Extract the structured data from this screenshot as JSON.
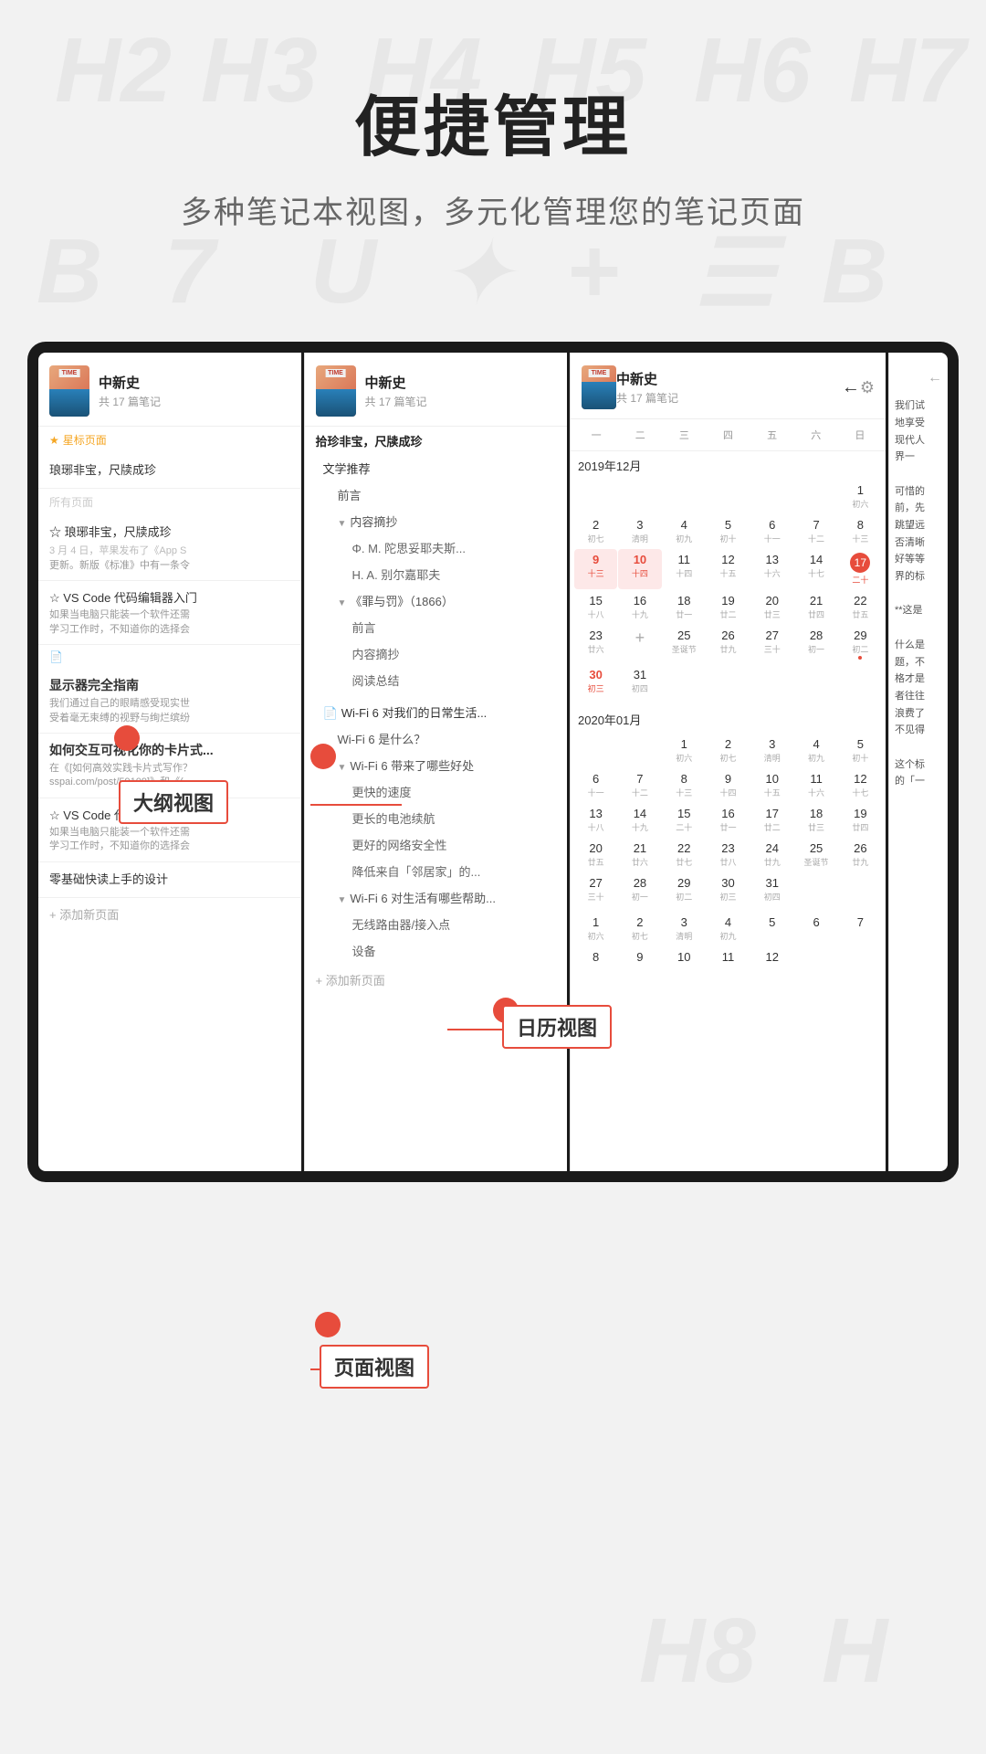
{
  "header": {
    "title": "便捷管理",
    "subtitle": "多种笔记本视图，多元化管理您的笔记页面"
  },
  "bg_chars": [
    "H2",
    "H3",
    "H4",
    "H5",
    "H6",
    "H7",
    "H8",
    "H",
    "H",
    "B",
    "7",
    "U",
    "+",
    "B"
  ],
  "notebook": {
    "name": "中新史",
    "count": "共 17 篇笔记"
  },
  "labels": {
    "outline": "大纲视图",
    "calendar": "日历视图",
    "page": "页面视图"
  },
  "panel1": {
    "starred_label": "星标页面",
    "all_label": "所有页面",
    "items": [
      {
        "title": "琅琊非宝，尺牍成珍",
        "date": "",
        "preview": "",
        "starred": true
      },
      {
        "title": "琅琊非宝，尺牍成珍",
        "date": "3 月 4 日，苹果发布了《App S",
        "preview": "更新。新版《标准》中有一条令",
        "starred": false
      },
      {
        "title": "VS Code 代码编辑器入门",
        "date": "",
        "preview": "如果当电脑只能装一个软件还需\n学习工作时，不知道你的选择会",
        "starred": false
      },
      {
        "title": "显示器完全指南",
        "date": "",
        "preview": "我们通过自己的眼睛感受现实世\n受着毫无束缚的视野与绚烂缤纷",
        "bold": true
      },
      {
        "title": "如何交互可视化你的卡片式...",
        "date": "",
        "preview": "在《[如何高效实践卡片式写作？\nsspai.com/post/59109]》和《(",
        "bold": true
      },
      {
        "title": "VS Code 代码编辑器入...",
        "date": "",
        "preview": "如果当电脑只能装一个软件还需\n学习工作时，不知道你的选择会"
      },
      {
        "title": "零基础快读上手的设计",
        "date": "",
        "preview": ""
      }
    ],
    "add_page": "+ 添加新页面"
  },
  "panel2": {
    "items": [
      {
        "text": "拾珍非宝，尺牍成珍",
        "level": 0
      },
      {
        "text": "文学推荐",
        "level": 0
      },
      {
        "text": "前言",
        "level": 1
      },
      {
        "text": "内容摘抄",
        "level": 1,
        "collapsed": true
      },
      {
        "text": "Φ. M. 陀思妥耶夫斯...",
        "level": 2
      },
      {
        "text": "H. A. 别尔嘉耶夫",
        "level": 2
      },
      {
        "text": "《罪与罚》（1866）",
        "level": 1,
        "collapsed": true
      },
      {
        "text": "前言",
        "level": 2
      },
      {
        "text": "内容摘抄",
        "level": 2
      },
      {
        "text": "阅读总结",
        "level": 2
      }
    ],
    "file_item": "Wi-Fi 6 对我们的日常生活...",
    "wifi_items": [
      {
        "text": "Wi-Fi 6 是什么？",
        "level": 1
      },
      {
        "text": "Wi-Fi 6 带来了哪些好处",
        "level": 1,
        "collapsed": true
      },
      {
        "text": "更快的速度",
        "level": 2
      },
      {
        "text": "更长的电池续航",
        "level": 2
      },
      {
        "text": "更好的网络安全性",
        "level": 2
      },
      {
        "text": "降低来自「邻居家」的...",
        "level": 2
      },
      {
        "text": "Wi-Fi 6 对生活有哪些帮助...",
        "level": 1,
        "collapsed": true
      },
      {
        "text": "无线路由器/接入点",
        "level": 2
      },
      {
        "text": "设备",
        "level": 2
      }
    ],
    "add_page": "+ 添加新页面"
  },
  "panel3": {
    "weekdays": [
      "一",
      "二",
      "三",
      "四",
      "五",
      "六",
      "日"
    ],
    "month1": "2019年12月",
    "month2": "2020年01月",
    "dec_rows": [
      [
        {
          "day": "",
          "lunar": ""
        },
        {
          "day": "",
          "lunar": ""
        },
        {
          "day": "",
          "lunar": ""
        },
        {
          "day": "",
          "lunar": ""
        },
        {
          "day": "",
          "lunar": ""
        },
        {
          "day": "",
          "lunar": ""
        },
        {
          "day": "1",
          "lunar": "初六"
        },
        {
          "day": "2",
          "lunar": "初七"
        },
        {
          "day": "3",
          "lunar": "清明"
        },
        {
          "day": "4",
          "lunar": "初九"
        }
      ],
      [
        {
          "day": "5",
          "lunar": "初十"
        },
        {
          "day": "6",
          "lunar": "十一"
        },
        {
          "day": "",
          "lunar": ""
        },
        {
          "day": "8",
          "lunar": "十二"
        },
        {
          "day": "9",
          "lunar": "十三",
          "highlight": true
        },
        {
          "day": "10",
          "lunar": "十四",
          "highlight": true
        },
        {
          "day": "11",
          "lunar": "十四"
        },
        {
          "day": "12",
          "lunar": "十五"
        }
      ],
      [
        {
          "day": "13",
          "lunar": "十六"
        },
        {
          "day": "14",
          "lunar": "十七"
        },
        {
          "day": "15",
          "lunar": "十八"
        },
        {
          "day": "16",
          "lunar": "十九"
        },
        {
          "day": "17",
          "lunar": "二十",
          "today": true
        },
        {
          "day": "18",
          "lunar": "廿一"
        },
        {
          "day": "19",
          "lunar": "廿二"
        }
      ],
      [
        {
          "day": "20",
          "lunar": "廿三"
        },
        {
          "day": "21",
          "lunar": "廿四"
        },
        {
          "day": "22",
          "lunar": "廿五"
        },
        {
          "day": "23",
          "lunar": "廿六"
        },
        {
          "day": "",
          "lunar": "",
          "add": true
        },
        {
          "day": "25",
          "lunar": "圣诞节"
        },
        {
          "day": "26",
          "lunar": "廿九"
        }
      ],
      [
        {
          "day": "27",
          "lunar": "三十"
        },
        {
          "day": "28",
          "lunar": "初一"
        },
        {
          "day": "29",
          "lunar": "初二",
          "dot": true
        },
        {
          "day": "30",
          "lunar": "初三",
          "red": true
        },
        {
          "day": "31",
          "lunar": "初四"
        },
        {
          "day": "",
          "lunar": ""
        },
        {
          "day": "",
          "lunar": ""
        }
      ]
    ],
    "jan_rows": [
      [
        {
          "day": "",
          "lunar": ""
        },
        {
          "day": "",
          "lunar": ""
        },
        {
          "day": "",
          "lunar": ""
        },
        {
          "day": "1",
          "lunar": "初六"
        },
        {
          "day": "2",
          "lunar": "初七"
        },
        {
          "day": "3",
          "lunar": "清明"
        },
        {
          "day": "4",
          "lunar": "初九"
        }
      ],
      [
        {
          "day": "5",
          "lunar": "初十"
        },
        {
          "day": "6",
          "lunar": "十一"
        },
        {
          "day": "7",
          "lunar": "十二"
        },
        {
          "day": "8",
          "lunar": "十三"
        },
        {
          "day": "9",
          "lunar": "十四"
        },
        {
          "day": "10",
          "lunar": "十五"
        },
        {
          "day": "11",
          "lunar": "十六"
        },
        {
          "day": "12",
          "lunar": "十七"
        }
      ],
      [
        {
          "day": "13",
          "lunar": "十八"
        },
        {
          "day": "14",
          "lunar": "十九"
        },
        {
          "day": "15",
          "lunar": "二十"
        },
        {
          "day": "16",
          "lunar": "廿一"
        },
        {
          "day": "17",
          "lunar": "廿二"
        },
        {
          "day": "18",
          "lunar": "廿三"
        },
        {
          "day": "19",
          "lunar": "廿四"
        }
      ],
      [
        {
          "day": "20",
          "lunar": "廿五"
        },
        {
          "day": "21",
          "lunar": "廿六"
        },
        {
          "day": "22",
          "lunar": "廿七"
        },
        {
          "day": "23",
          "lunar": "廿八"
        },
        {
          "day": "24",
          "lunar": "廿九"
        },
        {
          "day": "25",
          "lunar": "圣诞节"
        },
        {
          "day": "26",
          "lunar": "廿九"
        }
      ],
      [
        {
          "day": "27",
          "lunar": "三十"
        },
        {
          "day": "28",
          "lunar": "初一"
        },
        {
          "day": "29",
          "lunar": "初二"
        },
        {
          "day": "30",
          "lunar": "初三"
        },
        {
          "day": "31",
          "lunar": "初四"
        },
        {
          "day": "",
          "lunar": ""
        },
        {
          "day": "",
          "lunar": ""
        }
      ]
    ],
    "extra_row": [
      {
        "day": "1",
        "lunar": "初六"
      },
      {
        "day": "2",
        "lunar": "初七"
      },
      {
        "day": "3",
        "lunar": "清明"
      },
      {
        "day": "4",
        "lunar": "初九"
      },
      {
        "day": "5",
        "lunar": ""
      },
      {
        "day": "6",
        "lunar": ""
      },
      {
        "day": "7",
        "lunar": ""
      },
      {
        "day": "8",
        "lunar": ""
      },
      {
        "day": "9",
        "lunar": ""
      },
      {
        "day": "10",
        "lunar": ""
      },
      {
        "day": "11",
        "lunar": ""
      },
      {
        "day": "12",
        "lunar": ""
      }
    ]
  },
  "panel4": {
    "text": "我们试\n地享受\n现代人\n界一\n\n可惜的\n前，先\n跳望远\n否清晰\n好等等\n界的标\n\n**这是\n\n什么是\n题，不\n格才是\n者往往\n浪费了\n不见得\n\n这个标\n的「一"
  }
}
